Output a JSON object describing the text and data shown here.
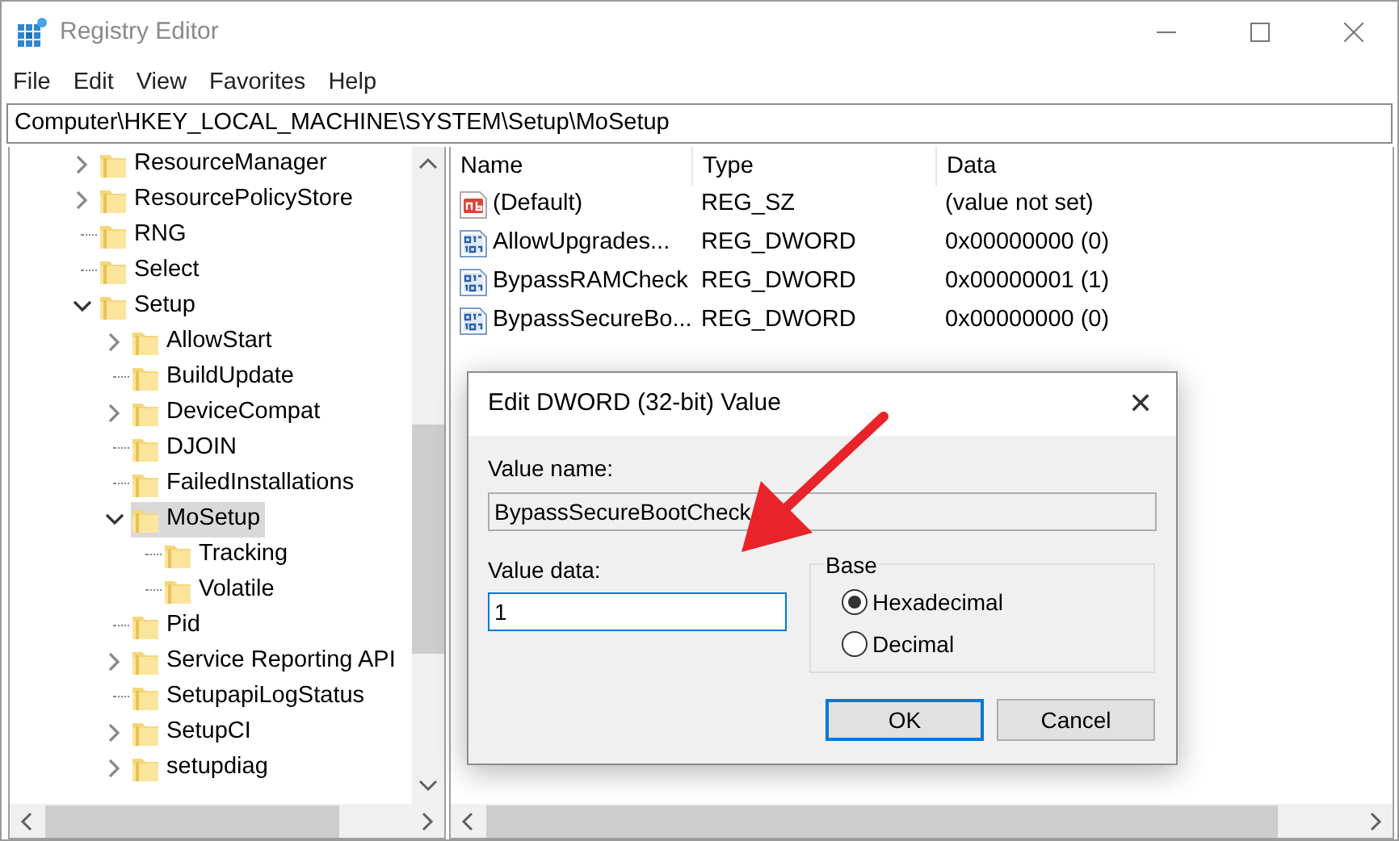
{
  "window": {
    "title": "Registry Editor"
  },
  "menu": [
    "File",
    "Edit",
    "View",
    "Favorites",
    "Help"
  ],
  "address": "Computer\\HKEY_LOCAL_MACHINE\\SYSTEM\\Setup\\MoSetup",
  "tree": [
    {
      "label": "ResourceManager",
      "expanded": false,
      "selected": false
    },
    {
      "label": "ResourcePolicyStore",
      "expanded": false,
      "selected": false
    },
    {
      "label": "RNG",
      "selected": false
    },
    {
      "label": "Select",
      "selected": false
    },
    {
      "label": "Setup",
      "expanded": true,
      "selected": false,
      "children": [
        {
          "label": "AllowStart",
          "expanded": false,
          "selected": false
        },
        {
          "label": "BuildUpdate",
          "selected": false
        },
        {
          "label": "DeviceCompat",
          "expanded": false,
          "selected": false
        },
        {
          "label": "DJOIN",
          "selected": false
        },
        {
          "label": "FailedInstallations",
          "selected": false
        },
        {
          "label": "MoSetup",
          "expanded": true,
          "selected": true,
          "children": [
            {
              "label": "Tracking",
              "selected": false
            },
            {
              "label": "Volatile",
              "selected": false
            }
          ]
        },
        {
          "label": "Pid",
          "selected": false
        },
        {
          "label": "Service Reporting API",
          "expanded": false,
          "selected": false
        },
        {
          "label": "SetupapiLogStatus",
          "selected": false
        },
        {
          "label": "SetupCI",
          "expanded": false,
          "selected": false
        },
        {
          "label": "setupdiag",
          "expanded": false,
          "selected": false
        }
      ]
    }
  ],
  "values": {
    "columns": [
      "Name",
      "Type",
      "Data"
    ],
    "rows": [
      {
        "kind": "string",
        "name": "(Default)",
        "type": "REG_SZ",
        "data": "(value not set)"
      },
      {
        "kind": "dword",
        "name": "AllowUpgrades...",
        "type": "REG_DWORD",
        "data": "0x00000000 (0)"
      },
      {
        "kind": "dword",
        "name": "BypassRAMCheck",
        "type": "REG_DWORD",
        "data": "0x00000001 (1)"
      },
      {
        "kind": "dword",
        "name": "BypassSecureBo...",
        "type": "REG_DWORD",
        "data": "0x00000000 (0)"
      }
    ]
  },
  "dialog": {
    "title": "Edit DWORD (32-bit) Value",
    "close": "✕",
    "value_name_label": "Value name:",
    "value_name": "BypassSecureBootCheck",
    "value_data_label": "Value data:",
    "value_data": "1",
    "base_label": "Base",
    "bases": [
      {
        "label": "Hexadecimal",
        "selected": true
      },
      {
        "label": "Decimal",
        "selected": false
      }
    ],
    "buttons": [
      {
        "label": "OK",
        "default": true
      },
      {
        "label": "Cancel",
        "default": false
      }
    ]
  }
}
